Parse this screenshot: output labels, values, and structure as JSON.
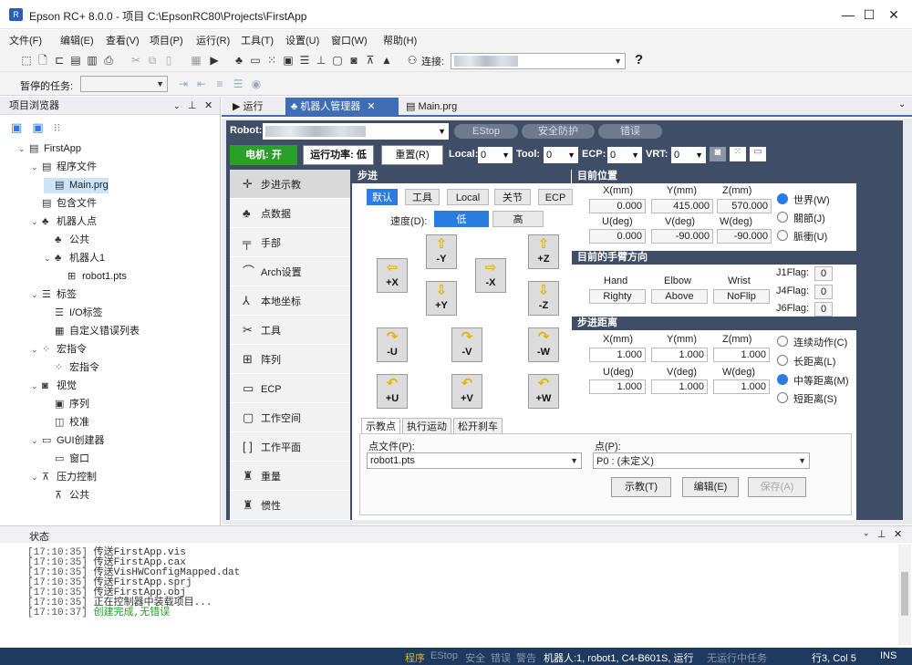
{
  "window": {
    "title": "Epson RC+ 8.0.0  - 项目 C:\\EpsonRC80\\Projects\\FirstApp",
    "min": "—",
    "max": "☐",
    "close": "✕"
  },
  "menu": [
    "文件(F)",
    "编辑(E)",
    "查看(V)",
    "项目(P)",
    "运行(R)",
    "工具(T)",
    "设置(U)",
    "窗口(W)",
    "帮助(H)"
  ],
  "toolbar": {
    "connect_label": "连接:",
    "help": "?"
  },
  "toolbar2": {
    "paused_label": "暂停的任务:"
  },
  "project_explorer": {
    "title": "项目浏览器",
    "items": [
      {
        "label": "FirstApp",
        "level": 0,
        "expand": "⌄",
        "icon": "doc-icon"
      },
      {
        "label": "程序文件",
        "level": 1,
        "expand": "⌄",
        "icon": "doc-icon"
      },
      {
        "label": "Main.prg",
        "level": 2,
        "expand": "",
        "icon": "doc-icon",
        "selected": true
      },
      {
        "label": "包含文件",
        "level": 1,
        "expand": "",
        "icon": "doc-icon"
      },
      {
        "label": "机器人点",
        "level": 1,
        "expand": "⌄",
        "icon": "robot-icon"
      },
      {
        "label": "公共",
        "level": 2,
        "expand": "",
        "icon": "robot-icon"
      },
      {
        "label": "机器人1",
        "level": 2,
        "expand": "⌄",
        "icon": "robot-icon"
      },
      {
        "label": "robot1.pts",
        "level": 3,
        "expand": "",
        "icon": "points-icon"
      },
      {
        "label": "标签",
        "level": 1,
        "expand": "⌄",
        "icon": "label-icon"
      },
      {
        "label": "I/O标签",
        "level": 2,
        "expand": "",
        "icon": "label-icon"
      },
      {
        "label": "自定义错误列表",
        "level": 2,
        "expand": "",
        "icon": "error-list-icon"
      },
      {
        "label": "宏指令",
        "level": 1,
        "expand": "⌄",
        "icon": "macro-icon"
      },
      {
        "label": "宏指令",
        "level": 2,
        "expand": "",
        "icon": "macro-icon"
      },
      {
        "label": "视觉",
        "level": 1,
        "expand": "⌄",
        "icon": "camera-icon"
      },
      {
        "label": "序列",
        "level": 2,
        "expand": "",
        "icon": "sequence-icon"
      },
      {
        "label": "校准",
        "level": 2,
        "expand": "",
        "icon": "calibration-icon"
      },
      {
        "label": "GUI创建器",
        "level": 1,
        "expand": "⌄",
        "icon": "gui-icon"
      },
      {
        "label": "窗口",
        "level": 2,
        "expand": "",
        "icon": "gui-icon"
      },
      {
        "label": "压力控制",
        "level": 1,
        "expand": "⌄",
        "icon": "force-icon"
      },
      {
        "label": "公共",
        "level": 2,
        "expand": "",
        "icon": "force-icon"
      }
    ]
  },
  "doc_tabs": [
    {
      "label": "运行",
      "active": false
    },
    {
      "label": "机器人管理器",
      "active": true,
      "close": "✕"
    },
    {
      "label": "Main.prg",
      "active": false
    }
  ],
  "robot_manager": {
    "robot_label": "Robot:",
    "estop": "EStop",
    "safeguard": "安全防护",
    "error": "错误",
    "motor_btn": "电机: 开",
    "power_btn": "运行功率: 低",
    "reset_btn": "重置(R)",
    "local_label": "Local:",
    "local_val": "0",
    "tool_label": "Tool:",
    "tool_val": "0",
    "ecp_label": "ECP:",
    "ecp_val": "0",
    "vrt_label": "VRT:",
    "vrt_val": "0"
  },
  "nav": [
    {
      "label": "步进示教",
      "icon": "✛",
      "active": true
    },
    {
      "label": "点数据",
      "icon": "♣",
      "active": false
    },
    {
      "label": "手部",
      "icon": "╤",
      "active": false
    },
    {
      "label": "Arch设置",
      "icon": "⌒",
      "active": false
    },
    {
      "label": "本地坐标",
      "icon": "⅄",
      "active": false
    },
    {
      "label": "工具",
      "icon": "✂",
      "active": false
    },
    {
      "label": "阵列",
      "icon": "⊞",
      "active": false
    },
    {
      "label": "ECP",
      "icon": "▭",
      "active": false
    },
    {
      "label": "工作空间",
      "icon": "▢",
      "active": false
    },
    {
      "label": "工作平面",
      "icon": "[ ]",
      "active": false
    },
    {
      "label": "重量",
      "icon": "♜",
      "active": false
    },
    {
      "label": "惯性",
      "icon": "♜",
      "active": false
    }
  ],
  "jog": {
    "title": "步进",
    "modes": [
      "默认",
      "工具",
      "Local",
      "关节",
      "ECP"
    ],
    "speed_label": "速度(D):",
    "speed_low": "低",
    "speed_high": "高",
    "buttons": {
      "ny": "-Y",
      "pz": "+Z",
      "px": "+X",
      "nx": "-X",
      "py": "+Y",
      "nz": "-Z",
      "nu": "-U",
      "nv": "-V",
      "nw": "-W",
      "pu": "+U",
      "pv": "+V",
      "pw": "+W"
    }
  },
  "current_pos": {
    "title": "目前位置",
    "headers": [
      "X(mm)",
      "Y(mm)",
      "Z(mm)"
    ],
    "values": [
      "0.000",
      "415.000",
      "570.000"
    ],
    "headers2": [
      "U(deg)",
      "V(deg)",
      "W(deg)"
    ],
    "values2": [
      "0.000",
      "-90.000",
      "-90.000"
    ],
    "radios": [
      {
        "label": "世界(W)",
        "on": true
      },
      {
        "label": "關節(J)",
        "on": false
      },
      {
        "label": "脈衝(U)",
        "on": false
      }
    ]
  },
  "arm_orientation": {
    "title": "目前的手臂方向",
    "headers": [
      "Hand",
      "Elbow",
      "Wrist"
    ],
    "values": [
      "Righty",
      "Above",
      "NoFlip"
    ],
    "flags": [
      {
        "label": "J1Flag:",
        "val": "0"
      },
      {
        "label": "J4Flag:",
        "val": "0"
      },
      {
        "label": "J6Flag:",
        "val": "0"
      }
    ]
  },
  "jog_distance": {
    "title": "步进距离",
    "headers": [
      "X(mm)",
      "Y(mm)",
      "Z(mm)"
    ],
    "values": [
      "1.000",
      "1.000",
      "1.000"
    ],
    "headers2": [
      "U(deg)",
      "V(deg)",
      "W(deg)"
    ],
    "values2": [
      "1.000",
      "1.000",
      "1.000"
    ],
    "radios": [
      {
        "label": "连续动作(C)",
        "on": false
      },
      {
        "label": "长距离(L)",
        "on": false
      },
      {
        "label": "中等距离(M)",
        "on": true
      },
      {
        "label": "短距离(S)",
        "on": false
      }
    ]
  },
  "teach": {
    "tabs": [
      "示教点",
      "执行运动",
      "松开刹车"
    ],
    "point_file_label": "点文件(P):",
    "point_file_val": "robot1.pts",
    "point_label": "点(P):",
    "point_val": "P0 : (未定义)",
    "teach_btn": "示教(T)",
    "edit_btn": "编辑(E)",
    "save_btn": "保存(A)"
  },
  "status_pane": {
    "title": "状态",
    "lines": [
      {
        "time": "[17:10:35]",
        "text": "传送FirstApp.vis",
        "ok": false
      },
      {
        "time": "[17:10:35]",
        "text": "传送FirstApp.cax",
        "ok": false
      },
      {
        "time": "[17:10:35]",
        "text": "传送VisHWConfigMapped.dat",
        "ok": false
      },
      {
        "time": "[17:10:35]",
        "text": "传送FirstApp.sprj",
        "ok": false
      },
      {
        "time": "[17:10:35]",
        "text": "传送FirstApp.obj",
        "ok": false
      },
      {
        "time": "[17:10:35]",
        "text": "正在控制器中装载项目...",
        "ok": false
      },
      {
        "time": "[17:10:37]",
        "text": "创建完成,无错误",
        "ok": true
      }
    ]
  },
  "statusbar": {
    "program": "程序",
    "estop": "EStop",
    "safe": "安全",
    "error": "错误",
    "warn": "警告",
    "robot": "机器人:1, robot1, C4-B601S, 运行",
    "tasks": "无运行中任务",
    "pos": "行3, Col 5",
    "ins": "INS"
  }
}
